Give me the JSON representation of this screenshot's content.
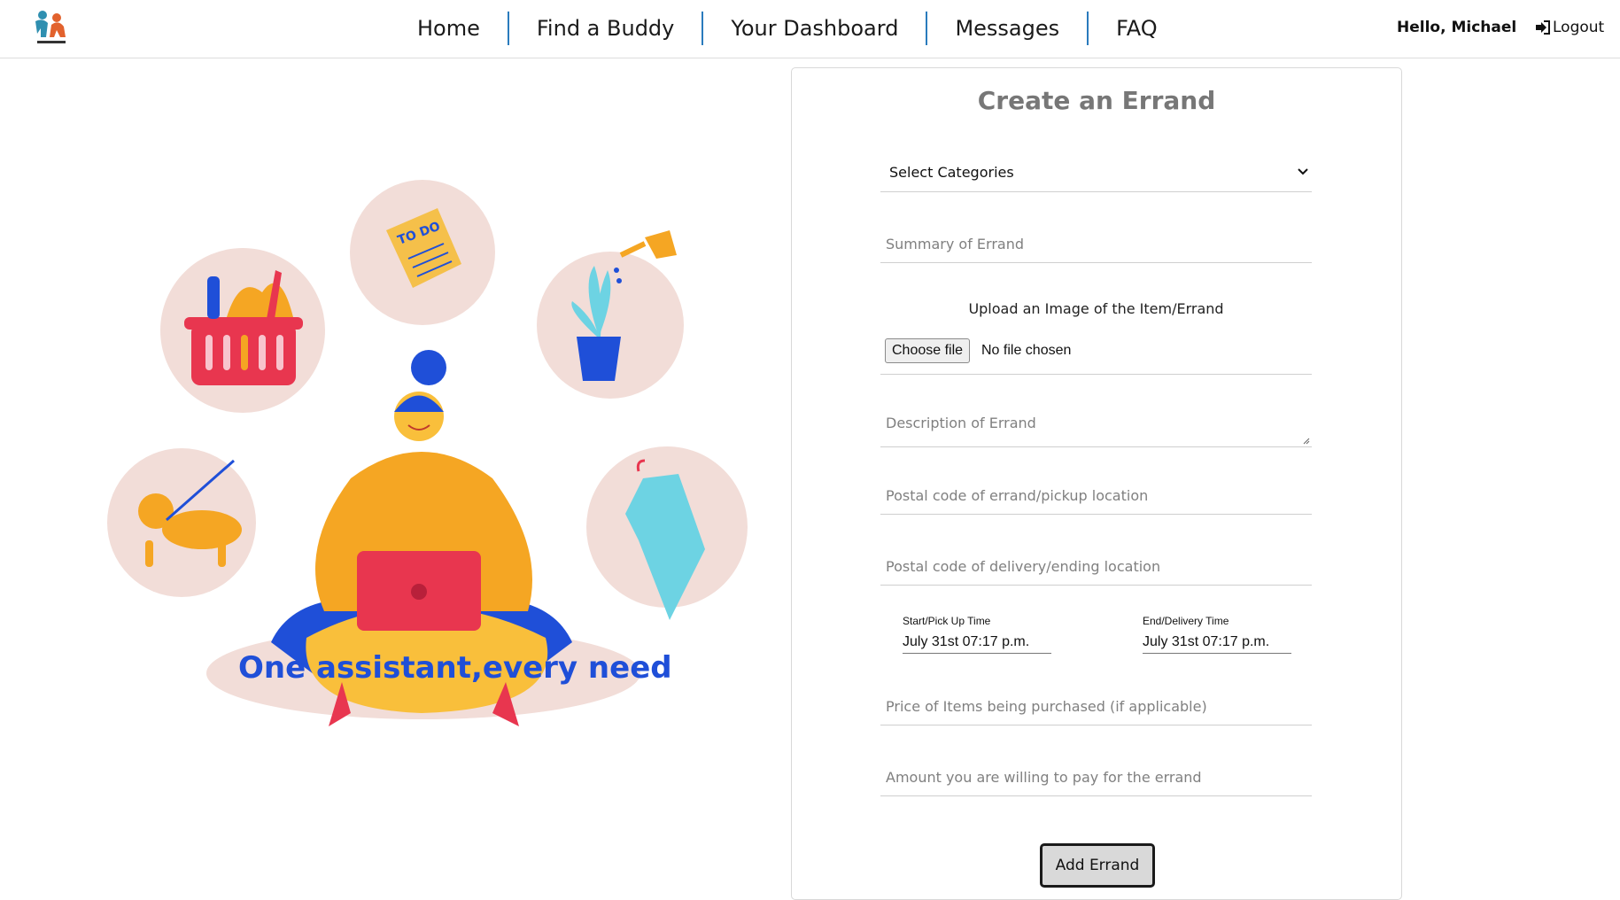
{
  "header": {
    "nav": [
      {
        "label": "Home"
      },
      {
        "label": "Find a Buddy"
      },
      {
        "label": "Your Dashboard"
      },
      {
        "label": "Messages"
      },
      {
        "label": "FAQ"
      }
    ],
    "greeting": "Hello, Michael",
    "logout_label": "Logout"
  },
  "illustration": {
    "tagline": "One assistant,every need",
    "todo_text": "TO DO"
  },
  "form": {
    "title": "Create an Errand",
    "category_select": "Select Categories",
    "summary_placeholder": "Summary of Errand",
    "upload_label": "Upload an Image of the Item/Errand",
    "file_button": "Choose file",
    "file_status": "No file chosen",
    "description_placeholder": "Description of Errand",
    "pickup_postal_placeholder": "Postal code of errand/pickup location",
    "delivery_postal_placeholder": "Postal code of delivery/ending location",
    "start_time_label": "Start/Pick Up Time",
    "start_time_value": "July 31st 07:17 p.m.",
    "end_time_label": "End/Delivery Time",
    "end_time_value": "July 31st 07:17 p.m.",
    "price_placeholder": "Price of Items being purchased (if applicable)",
    "payment_placeholder": "Amount you are willing to pay for the errand",
    "submit_label": "Add Errand"
  },
  "colors": {
    "nav_separator": "#2a7bbd",
    "title_gray": "#777777",
    "accent_blue": "#1f4fd8",
    "accent_orange": "#f5a623",
    "accent_pink": "#e8364f",
    "circle_bg": "#f2ddd8"
  }
}
